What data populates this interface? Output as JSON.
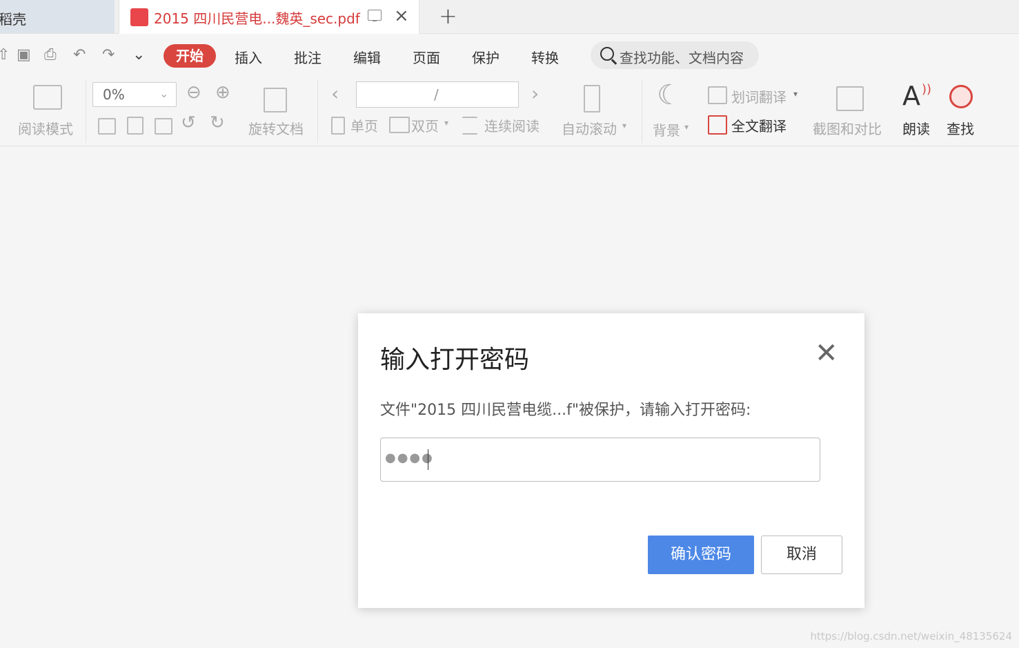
{
  "tabs": {
    "prev_label": "稻壳",
    "active_label": "2015 四川民营电...魏英_sec.pdf",
    "close_glyph": "×",
    "new_glyph": "+"
  },
  "menu": {
    "items": [
      "开始",
      "插入",
      "批注",
      "编辑",
      "页面",
      "保护",
      "转换"
    ],
    "search_placeholder": "查找功能、文档内容",
    "accent": "#d9463f"
  },
  "toolbar": {
    "read_mode": "阅读模式",
    "zoom_value": "0%",
    "rotate_doc": "旋转文档",
    "page_sep": "/",
    "single_page": "单页",
    "double_page": "双页",
    "continuous_read": "连续阅读",
    "auto_scroll": "自动滚动",
    "background": "背景",
    "word_translate": "划词翻译",
    "full_translate": "全文翻译",
    "screenshot_compare": "截图和对比",
    "read_aloud": "朗读",
    "find": "查找"
  },
  "dialog": {
    "title": "输入打开密码",
    "message": "文件\"2015 四川民营电缆...f\"被保护，请输入打开密码:",
    "password_mask": "●●●●",
    "confirm_label": "确认密码",
    "cancel_label": "取消",
    "confirm_color": "#4d88e7"
  },
  "watermark": "https://blog.csdn.net/weixin_48135624"
}
